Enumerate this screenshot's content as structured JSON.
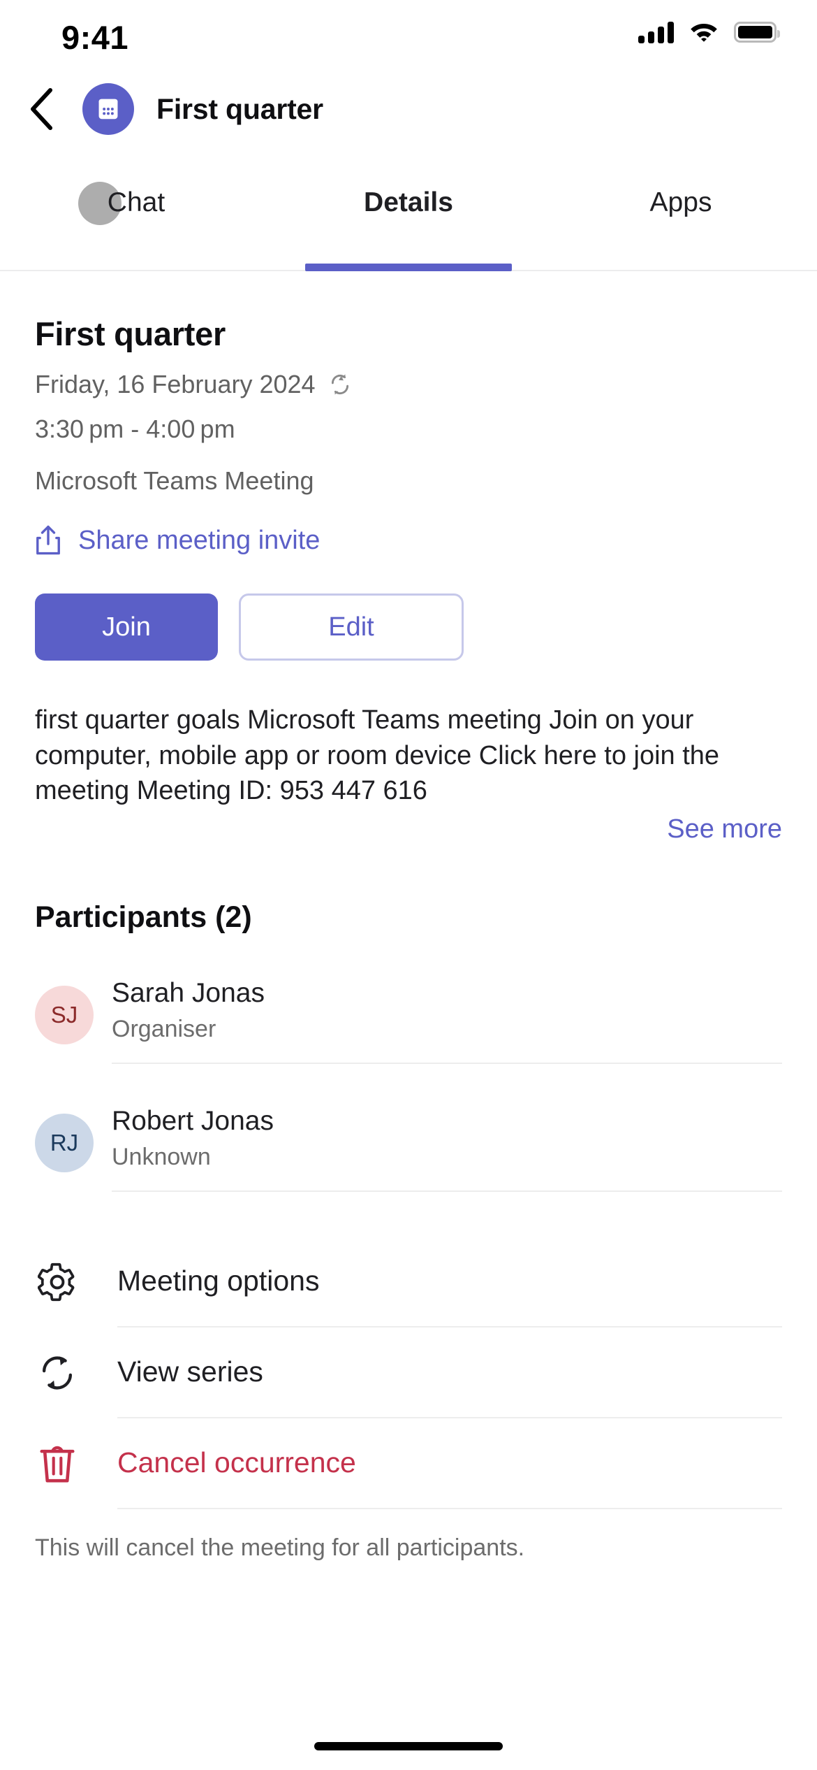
{
  "status_bar": {
    "time": "9:41",
    "signal_icon": "cellular-signal-icon",
    "wifi_icon": "wifi-icon",
    "battery_icon": "battery-full-icon"
  },
  "header": {
    "back_icon": "chevron-left-icon",
    "avatar_icon": "calendar-icon",
    "title": "First quarter"
  },
  "tabs": [
    {
      "label": "Chat",
      "active": false
    },
    {
      "label": "Details",
      "active": true
    },
    {
      "label": "Apps",
      "active": false
    }
  ],
  "meeting": {
    "title": "First quarter",
    "date": "Friday, 16 February 2024",
    "recurrence_icon": "recurring-icon",
    "time": "3:30 pm - 4:00 pm",
    "type": "Microsoft Teams Meeting",
    "share_icon": "share-icon",
    "share_label": "Share meeting invite",
    "join_label": "Join",
    "edit_label": "Edit",
    "description": "first quarter goals Microsoft Teams meeting Join on your computer, mobile app or room device Click here to join the meeting Meeting ID: 953 447 616",
    "see_more_label": "See more"
  },
  "participants_section": {
    "title": "Participants (2)",
    "items": [
      {
        "initials": "SJ",
        "name": "Sarah Jonas",
        "role": "Organiser",
        "avatar_bg": "#f7d9d9",
        "avatar_fg": "#8b2a2a"
      },
      {
        "initials": "RJ",
        "name": "Robert Jonas",
        "role": "Unknown",
        "avatar_bg": "#ccd8e8",
        "avatar_fg": "#1b3a5c"
      }
    ]
  },
  "actions": [
    {
      "label": "Meeting options",
      "icon": "gear-icon",
      "danger": false
    },
    {
      "label": "View series",
      "icon": "recurring-icon",
      "danger": false
    },
    {
      "label": "Cancel occurrence",
      "icon": "trash-icon",
      "danger": true
    }
  ],
  "footnote": "This will cancel the meeting for all participants.",
  "colors": {
    "accent": "#5b5fc7",
    "danger": "#c4314b",
    "text_primary": "#1f1f23",
    "text_secondary": "#616161",
    "divider": "#ededed"
  }
}
